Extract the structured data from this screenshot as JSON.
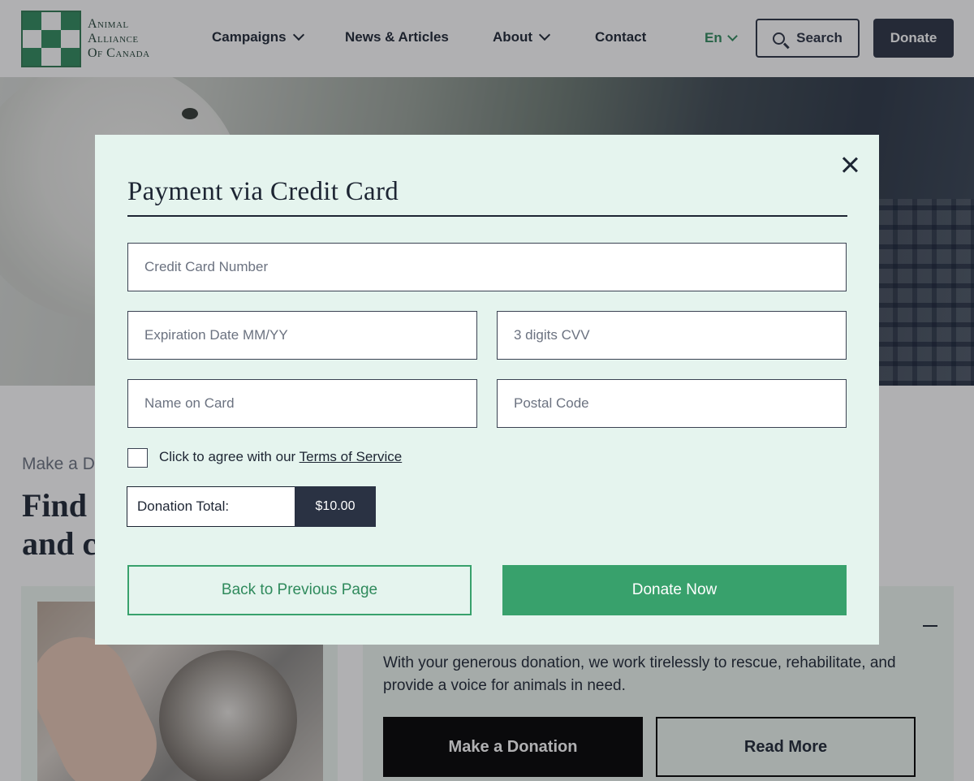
{
  "header": {
    "logo_lines": [
      "Animal",
      "Alliance",
      "Of Canada"
    ],
    "nav": [
      {
        "label": "Campaigns",
        "has_dropdown": true
      },
      {
        "label": "News & Articles",
        "has_dropdown": false
      },
      {
        "label": "About",
        "has_dropdown": true
      },
      {
        "label": "Contact",
        "has_dropdown": false
      }
    ],
    "language": "En",
    "search_label": "Search",
    "donate_label": "Donate"
  },
  "page": {
    "eyebrow": "Make a D",
    "heading_line1": "Find",
    "heading_line2": "and c",
    "card_text": "With your generous donation, we work tirelessly to rescue, rehabilitate, and provide a voice for animals in need.",
    "make_donation_label": "Make a Donation",
    "read_more_label": "Read More"
  },
  "modal": {
    "title": "Payment via Credit Card",
    "fields": {
      "card_number": {
        "placeholder": "Credit Card Number",
        "value": ""
      },
      "expiration": {
        "placeholder": "Expiration Date MM/YY",
        "value": ""
      },
      "cvv": {
        "placeholder": "3 digits CVV",
        "value": ""
      },
      "name": {
        "placeholder": "Name on Card",
        "value": ""
      },
      "postal": {
        "placeholder": "Postal Code",
        "value": ""
      }
    },
    "agree_prefix": "Click to agree with our ",
    "agree_link": "Terms of Service",
    "agree_checked": false,
    "total_label": "Donation Total:",
    "total_value": "$10.00",
    "back_label": "Back to Previous Page",
    "donate_now_label": "Donate Now"
  },
  "colors": {
    "brand_green": "#38a16c",
    "navy": "#2a3243",
    "modal_bg": "#e5f4ee"
  },
  "icons": [
    "search-icon",
    "chevron-down-icon",
    "close-icon",
    "collapse-icon"
  ]
}
